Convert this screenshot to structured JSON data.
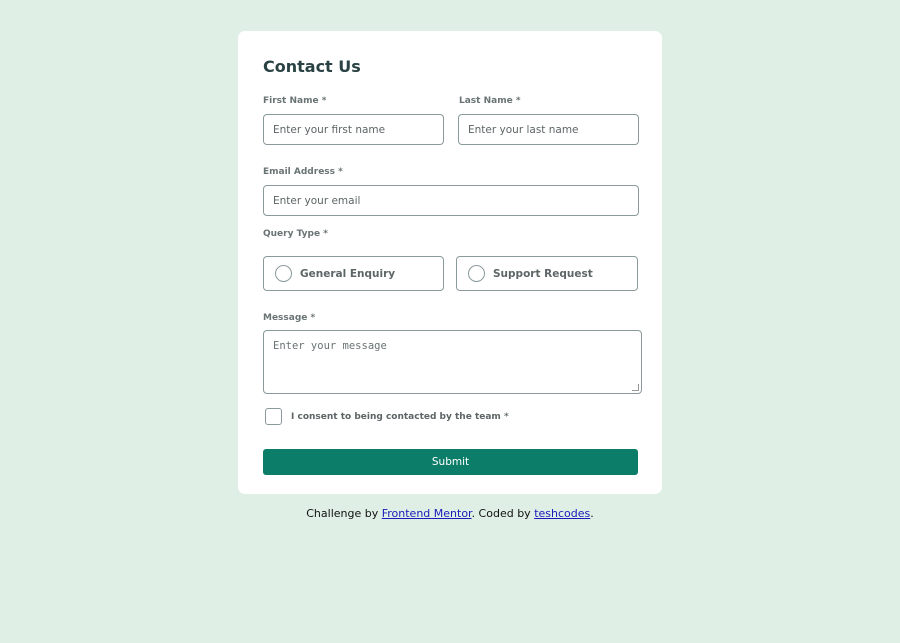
{
  "form": {
    "title": "Contact Us",
    "first_name_label": "First Name",
    "first_name_placeholder": "Enter your first name",
    "last_name_label": "Last Name",
    "last_name_placeholder": "Enter your last name",
    "email_label": "Email Address",
    "email_placeholder": "Enter your email",
    "query_type_label": "Query Type",
    "query_options": [
      "General Enquiry",
      "Support Request"
    ],
    "message_label": "Message",
    "message_placeholder": "Enter your message",
    "consent_label": "I consent to being contacted by the team",
    "required_marker": "*",
    "submit_label": "Submit"
  },
  "footer": {
    "prefix": "Challenge by",
    "link1": "Frontend Mentor",
    "middle": ". Coded by",
    "link2": "teshcodes",
    "suffix": "."
  },
  "colors": {
    "background": "#dfefe6",
    "accent": "#0c7d69"
  }
}
